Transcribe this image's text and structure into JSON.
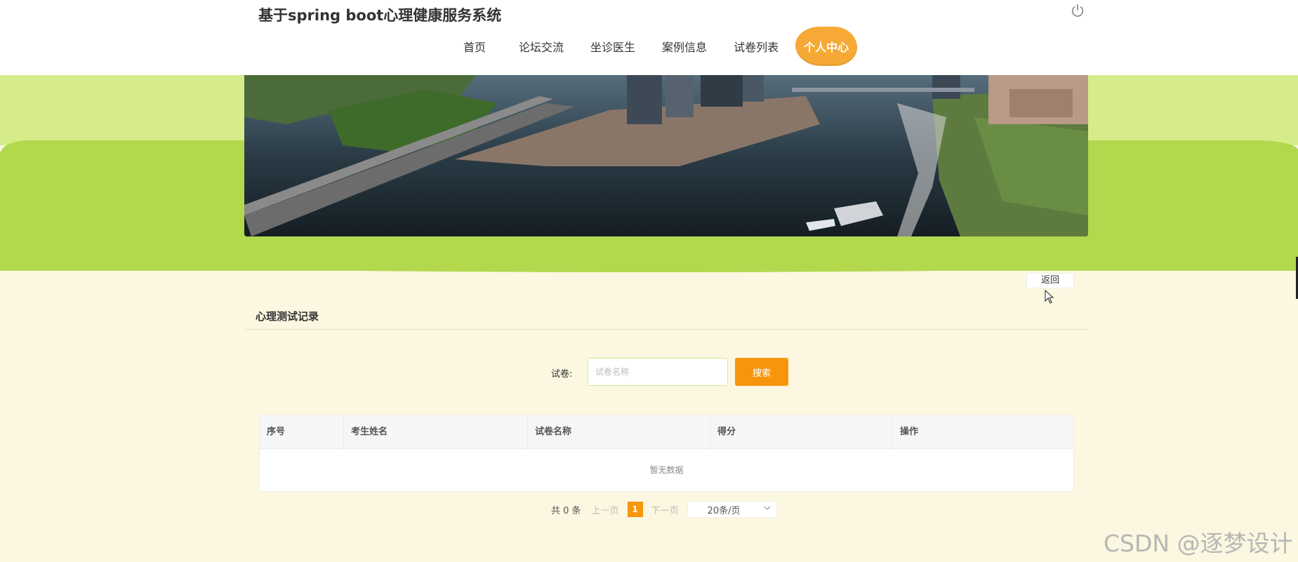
{
  "header": {
    "title": "基于spring boot心理健康服务系统",
    "nav": [
      {
        "label": "首页"
      },
      {
        "label": "论坛交流"
      },
      {
        "label": "坐诊医生"
      },
      {
        "label": "案例信息"
      },
      {
        "label": "试卷列表"
      },
      {
        "label": "个人中心",
        "active": true
      }
    ],
    "power_icon": "power-icon"
  },
  "return_label": "返回",
  "section": {
    "title": "心理测试记录"
  },
  "search": {
    "label": "试卷:",
    "placeholder": "试卷名称",
    "button": "搜索"
  },
  "table": {
    "columns": [
      "序号",
      "考生姓名",
      "试卷名称",
      "得分",
      "操作"
    ],
    "rows": [],
    "empty_text": "暂无数据"
  },
  "pagination": {
    "total": "共 0 条",
    "prev": "上一页",
    "current_page": "1",
    "next": "下一页",
    "page_size": "20条/页"
  },
  "watermark": "CSDN @逐梦设计",
  "colors": {
    "accent": "#f7960c",
    "nav_active_bg": "#f6a935",
    "band_green": "#b2d84e",
    "band_light": "#d6ec8a",
    "page_bg": "#fbf7e0"
  }
}
